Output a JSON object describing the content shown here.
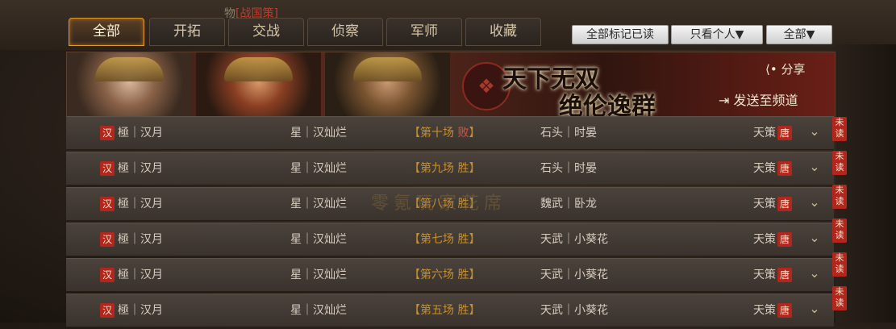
{
  "breadcrumb": {
    "prefix": "物",
    "highlight": "[战国策]"
  },
  "tabs": [
    {
      "label": "全部",
      "active": true
    },
    {
      "label": "开拓",
      "active": false
    },
    {
      "label": "交战",
      "active": false
    },
    {
      "label": "侦察",
      "active": false
    },
    {
      "label": "军师",
      "active": false
    },
    {
      "label": "收藏",
      "active": false
    }
  ],
  "toolbar": {
    "mark_all_read": "全部标记已读",
    "filter_person": "只看个人▼",
    "filter_all": "全部▼"
  },
  "banner": {
    "title_line1": "天下无双",
    "title_line2": "绝伦逸群",
    "share": "分享",
    "send_to_channel": "发送至频道"
  },
  "watermark": "零氪玩家花席",
  "reports": [
    {
      "faction": "汉",
      "attacker": "極｜汉月",
      "opponent_left": "星｜汉灿烂",
      "match": "【第十场 败】",
      "match_no": "第十场",
      "result": "败",
      "opponent_right": "石头｜时晏",
      "server": "天策",
      "server_badge": "唐",
      "status": "未读"
    },
    {
      "faction": "汉",
      "attacker": "極｜汉月",
      "opponent_left": "星｜汉灿烂",
      "match": "【第九场 胜】",
      "match_no": "第九场",
      "result": "胜",
      "opponent_right": "石头｜时晏",
      "server": "天策",
      "server_badge": "唐",
      "status": "未读"
    },
    {
      "faction": "汉",
      "attacker": "極｜汉月",
      "opponent_left": "星｜汉灿烂",
      "match": "【第八场 胜】",
      "match_no": "第八场",
      "result": "胜",
      "opponent_right": "魏武｜卧龙",
      "server": "天策",
      "server_badge": "唐",
      "status": "未读"
    },
    {
      "faction": "汉",
      "attacker": "極｜汉月",
      "opponent_left": "星｜汉灿烂",
      "match": "【第七场 胜】",
      "match_no": "第七场",
      "result": "胜",
      "opponent_right": "天武｜小葵花",
      "server": "天策",
      "server_badge": "唐",
      "status": "未读"
    },
    {
      "faction": "汉",
      "attacker": "極｜汉月",
      "opponent_left": "星｜汉灿烂",
      "match": "【第六场 胜】",
      "match_no": "第六场",
      "result": "胜",
      "opponent_right": "天武｜小葵花",
      "server": "天策",
      "server_badge": "唐",
      "status": "未读"
    },
    {
      "faction": "汉",
      "attacker": "極｜汉月",
      "opponent_left": "星｜汉灿烂",
      "match": "【第五场 胜】",
      "match_no": "第五场",
      "result": "胜",
      "opponent_right": "天武｜小葵花",
      "server": "天策",
      "server_badge": "唐",
      "status": "未读"
    }
  ],
  "colors": {
    "accent": "#e39a2e",
    "badge_red": "#b3261e",
    "loss": "#e0523a",
    "win": "#c98f2a"
  }
}
